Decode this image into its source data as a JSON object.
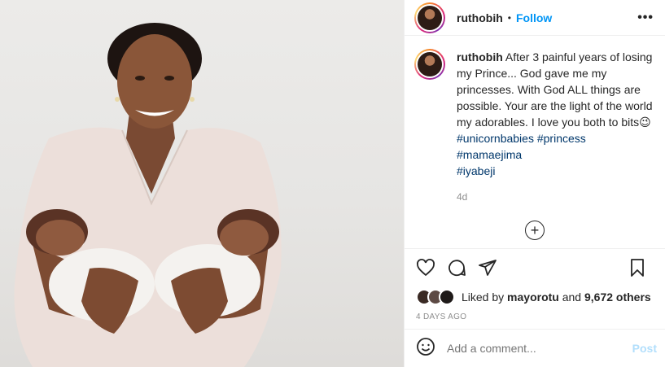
{
  "header": {
    "username": "ruthobih",
    "separator": "•",
    "follow_label": "Follow",
    "more_label": "•••"
  },
  "caption": {
    "username": "ruthobih",
    "text": "After 3 painful years of losing my Prince... God gave me my princesses. With God ALL things are possible. Your are the light of the world my adorables. I love you both to bits😉",
    "hashtags": [
      "#unicornbabies",
      "#princess",
      "#mamaejima",
      "#iyabeji"
    ],
    "age": "4d"
  },
  "load_more_label": "+",
  "actions": {
    "icons": [
      "heart-icon",
      "comment-icon",
      "share-icon",
      "bookmark-icon"
    ]
  },
  "likes": {
    "prefix": "Liked by",
    "user": "mayorotu",
    "and": "and",
    "count_text": "9,672 others"
  },
  "timestamp": "4 DAYS AGO",
  "comment_box": {
    "placeholder": "Add a comment...",
    "post_label": "Post"
  },
  "colors": {
    "follow": "#0095f6",
    "hashtag": "#00376b",
    "muted": "#8e8e8e",
    "post_disabled": "#b2dffc"
  }
}
